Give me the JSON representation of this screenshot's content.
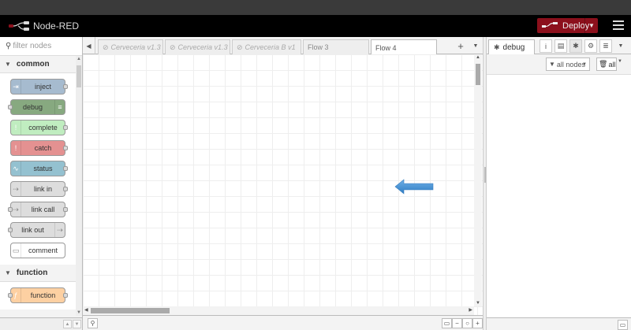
{
  "app": {
    "title": "Node-RED"
  },
  "header": {
    "deploy_label": "Deploy"
  },
  "palette": {
    "search_placeholder": "filter nodes",
    "categories": [
      {
        "label": "common",
        "nodes": [
          {
            "label": "inject",
            "color": "#a6bbcf",
            "icon": "arrow-right-icon",
            "in": false,
            "out": true
          },
          {
            "label": "debug",
            "color": "#87a980",
            "icon": "list-icon",
            "in": true,
            "out": false,
            "icon_right": true
          },
          {
            "label": "complete",
            "color": "#c0edc0",
            "icon": "exclamation-icon",
            "in": false,
            "out": true
          },
          {
            "label": "catch",
            "color": "#e49191",
            "icon": "exclamation-icon",
            "in": false,
            "out": true
          },
          {
            "label": "status",
            "color": "#94c1d0",
            "icon": "pulse-icon",
            "in": false,
            "out": true
          },
          {
            "label": "link in",
            "color": "#dddddd",
            "icon": "link-icon",
            "in": false,
            "out": true
          },
          {
            "label": "link call",
            "color": "#dddddd",
            "icon": "link-icon",
            "in": true,
            "out": true
          },
          {
            "label": "link out",
            "color": "#dddddd",
            "icon": "link-icon",
            "in": true,
            "out": false,
            "icon_right": true
          },
          {
            "label": "comment",
            "color": "#ffffff",
            "icon": "comment-icon",
            "in": false,
            "out": false
          }
        ]
      },
      {
        "label": "function",
        "nodes": [
          {
            "label": "function",
            "color": "#fdd0a2",
            "icon": "function-icon",
            "in": true,
            "out": true
          }
        ]
      }
    ]
  },
  "tabs": [
    {
      "label": "Cerveceria v1.3",
      "disabled": true
    },
    {
      "label": "Cerveceria v1.3",
      "disabled": true
    },
    {
      "label": "Cerveceria B v1",
      "disabled": true
    },
    {
      "label": "Flow 3",
      "disabled": false
    },
    {
      "label": "Flow 4",
      "disabled": false,
      "active": true
    }
  ],
  "sidebar": {
    "active_tab": "debug",
    "filter_label": "all nodes",
    "clear_label": "all"
  },
  "colors": {
    "deploy": "#8c101c",
    "arrow": "#4a90d2"
  }
}
